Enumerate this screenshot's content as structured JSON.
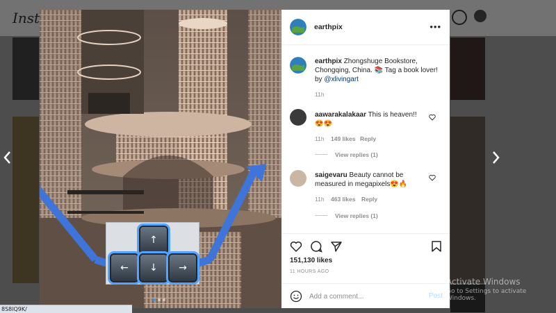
{
  "app": {
    "logo_text": "Insta"
  },
  "post": {
    "username": "earthpix",
    "caption": "Zhongshuge Bookstore, Chongqing, China. 📚 Tag a book lover! by",
    "caption_mention": "@xlivingart",
    "caption_time": "11h",
    "comments": [
      {
        "username": "aawarakalakaar",
        "text": "This is heaven!! 😍😍",
        "time": "11h",
        "likes": "149 likes",
        "reply_label": "Reply",
        "view_replies": "View replies (1)"
      },
      {
        "username": "saigevaru",
        "text": "Beauty cannot be measured in megapixels😍🔥",
        "time": "11h",
        "likes": "463 likes",
        "reply_label": "Reply",
        "view_replies": "View replies (1)"
      }
    ],
    "likes_count": "151,130 likes",
    "posted_ago": "11 HOURS AGO",
    "comment_placeholder": "Add a comment...",
    "post_label": "Post",
    "more_label": "•••"
  },
  "keyboard": {
    "up": "↑",
    "left": "←",
    "down": "↓",
    "right": "→"
  },
  "watermark": {
    "title": "Activate Windows",
    "subtitle": "Go to Settings to activate Windows."
  },
  "status_bar": {
    "url": "8S8lQ9K/"
  },
  "colors": {
    "accent": "#3897f0",
    "arrow": "#3f74d9",
    "key_glow": "#53a3ff"
  },
  "icons": [
    "chevron-left-icon",
    "chevron-right-icon",
    "heart-icon",
    "comment-icon",
    "share-icon",
    "bookmark-icon",
    "emoji-icon",
    "more-icon"
  ]
}
